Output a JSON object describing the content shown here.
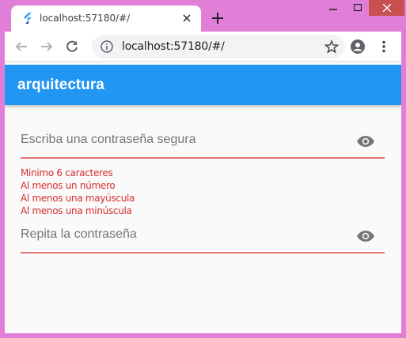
{
  "browser": {
    "tab_title": "localhost:57180/#/",
    "url": "localhost:57180/#/"
  },
  "app": {
    "title": "arquitectura"
  },
  "form": {
    "password_label": "Escriba una contraseña segura",
    "confirm_label": "Repita la contraseña",
    "errors": [
      "Minimo 6 caracteres",
      "Al menos un número",
      "Al menos una mayúscula",
      "Al menos una minúscula"
    ]
  },
  "colors": {
    "app_bar": "#2196f3",
    "error": "#d32f2f",
    "underline": "#e57373",
    "window_frame": "#e17fd8"
  },
  "icons": {
    "favicon": "flutter-icon",
    "visibility": "eye-icon"
  }
}
